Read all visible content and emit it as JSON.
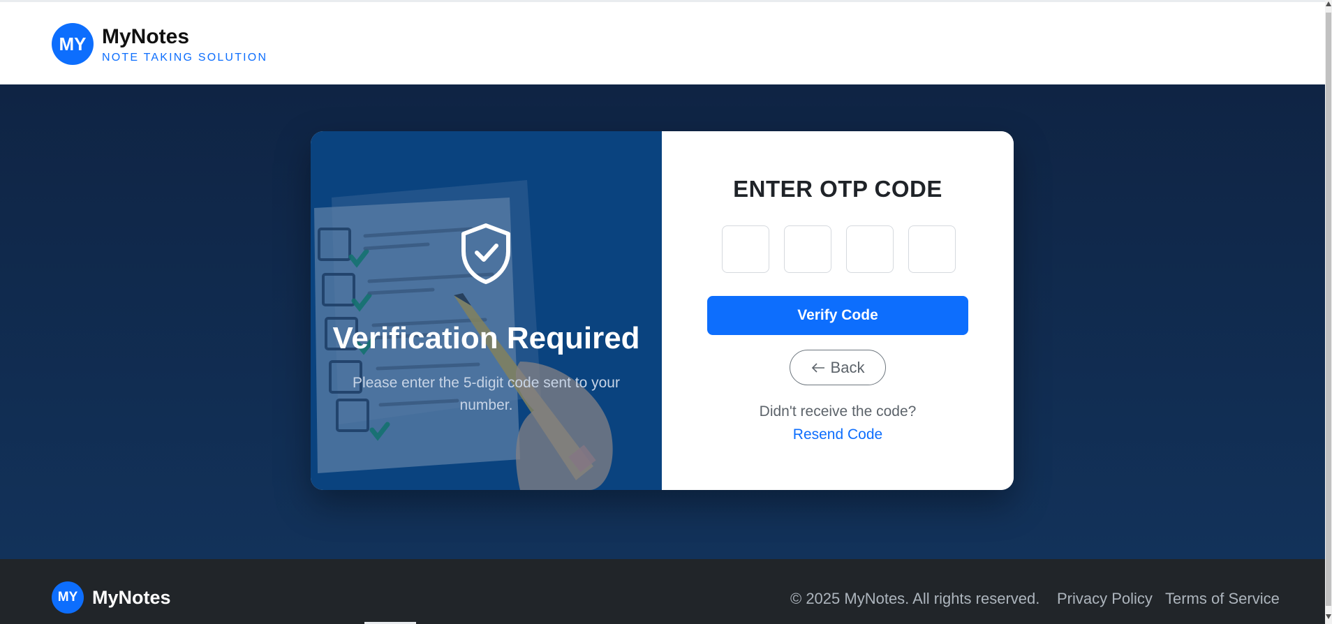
{
  "header": {
    "logo_text": "MY",
    "brand_name": "MyNotes",
    "brand_tagline": "NOTE TAKING SOLUTION"
  },
  "left_panel": {
    "icon": "shield-check-icon",
    "title": "Verification Required",
    "subtitle": "Please enter the 5-digit code sent to your number."
  },
  "form": {
    "title": "ENTER OTP CODE",
    "otp_boxes": [
      "",
      "",
      "",
      ""
    ],
    "verify_label": "Verify Code",
    "back_label": "Back",
    "back_icon": "arrow-left-icon",
    "resend_prompt": "Didn't receive the code?",
    "resend_label": "Resend Code"
  },
  "footer": {
    "logo_text": "MY",
    "brand_name": "MyNotes",
    "copyright": "© 2025 MyNotes. All rights reserved.",
    "privacy_label": "Privacy Policy",
    "terms_label": "Terms of Service"
  },
  "colors": {
    "primary": "#0d6efd",
    "background": "#0f2444",
    "footer": "#212529"
  }
}
